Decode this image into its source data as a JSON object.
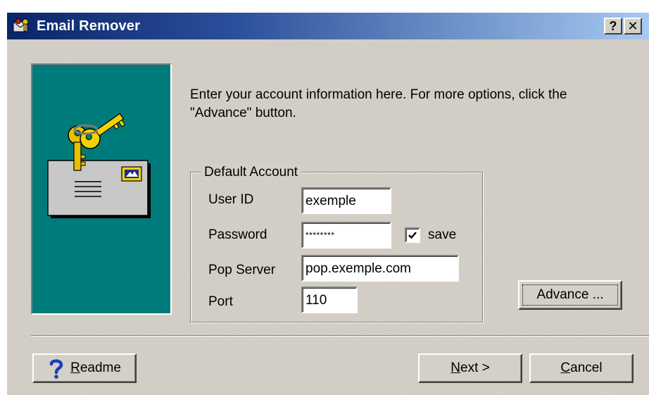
{
  "window": {
    "title": "Email Remover",
    "help_glyph": "?",
    "close_glyph": "✕"
  },
  "intro": {
    "text": "Enter your account information here.   For more options, click the \"Advance\" button."
  },
  "account": {
    "group_title": "Default Account",
    "user_id_label": "User ID",
    "user_id_value": "exemple",
    "password_label": "Password",
    "password_value": "********",
    "save_checked": true,
    "save_label": "save",
    "pop_server_label": "Pop Server",
    "pop_server_value": "pop.exemple.com",
    "port_label": "Port",
    "port_value": "110"
  },
  "buttons": {
    "advance_label": "Advance ...",
    "readme_mnemonic": "R",
    "readme_rest": "eadme",
    "next_mnemonic": "N",
    "next_rest": "ext >",
    "cancel_mnemonic": "C",
    "cancel_rest": "ancel"
  },
  "icons": {
    "title": "email-remover-app-icon",
    "art": "envelope-with-keys-illustration",
    "readme": "question-mark-icon",
    "checkbox": "checkmark-icon"
  },
  "colors": {
    "titlebar_start": "#0a246a",
    "titlebar_end": "#a6caf0",
    "dialog_face": "#d4d0c8",
    "art_background": "#007b7b",
    "help_icon_blue": "#1a3fb8"
  }
}
